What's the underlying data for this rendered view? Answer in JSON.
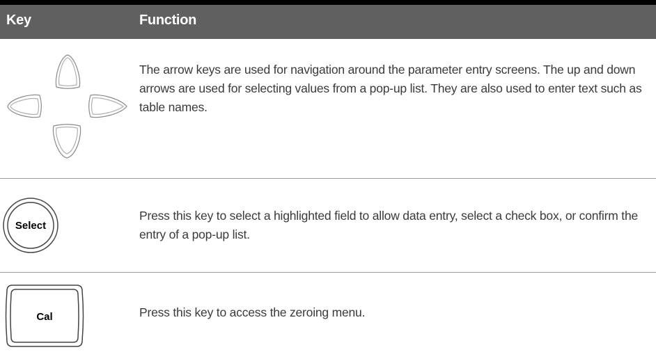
{
  "table": {
    "headers": {
      "key": "Key",
      "function": "Function"
    },
    "rows": [
      {
        "key_icon": "arrow-keys-icon",
        "description": "The arrow keys are used for navigation around the parameter entry screens. The up and down arrows are used for selecting values from a pop-up list. They are also used to enter text such as table names."
      },
      {
        "key_icon": "select-key-icon",
        "key_label": "Select",
        "description": "Press this key to select a highlighted field to allow data entry, select a check box, or confirm the entry of a pop-up list."
      },
      {
        "key_icon": "cal-key-icon",
        "key_label": "Cal",
        "description": "Press this key to access the zeroing menu."
      }
    ]
  }
}
